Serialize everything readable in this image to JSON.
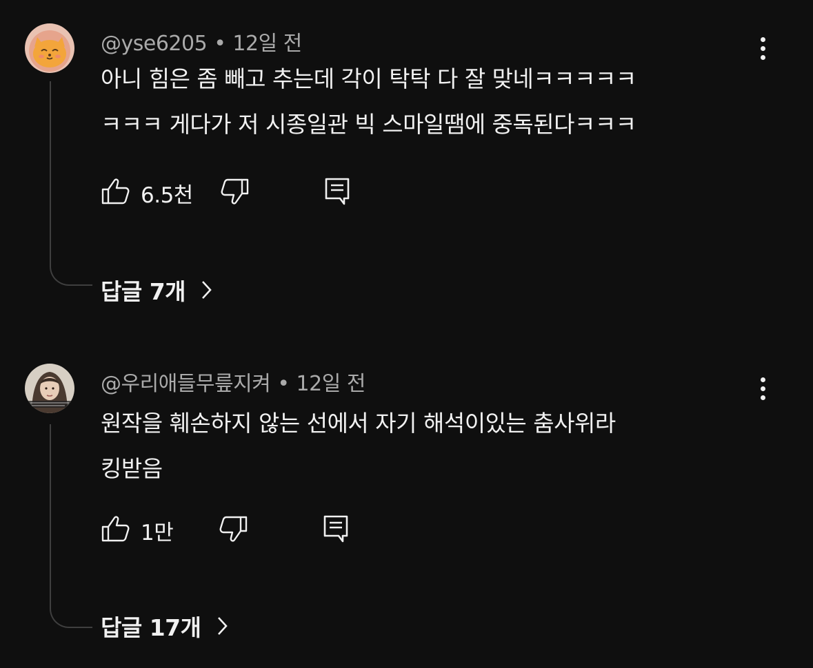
{
  "comments": [
    {
      "author": "@yse6205",
      "separator": "•",
      "time": "12일 전",
      "text_lines": [
        "아니 힘은 좀 빼고 추는데 각이 탁탁 다 잘 맞네ㅋㅋㅋㅋㅋ",
        "ㅋㅋㅋ 게다가 저 시종일관 빅 스마일땜에 중독된다ㅋㅋㅋ"
      ],
      "likes": "6.5천",
      "replies_label": "답글 7개",
      "avatar_icon": "cartoon-cat-avatar",
      "colors": {
        "avatar_bg": "#e8b6a2",
        "avatar_face": "#f2a43a"
      }
    },
    {
      "author": "@우리애들무릎지켜",
      "separator": "•",
      "time": "12일 전",
      "text_lines": [
        "원작을 훼손하지 않는 선에서 자기 해석이있는 춤사위라",
        "킹받음"
      ],
      "likes": "1만",
      "replies_label": "답글 17개",
      "avatar_icon": "photo-avatar",
      "colors": {
        "avatar_bg": "#b9a89a"
      }
    }
  ],
  "icons": {
    "like": "thumbs-up-icon",
    "dislike": "thumbs-down-icon",
    "reply": "comment-reply-icon",
    "more": "more-vertical-icon",
    "chevron": "chevron-right-icon"
  },
  "colors": {
    "background": "#0f0f0f",
    "primary_text": "#f1f1f1",
    "secondary_text": "#aaaaaa",
    "thread_line": "#3f3f3f"
  }
}
